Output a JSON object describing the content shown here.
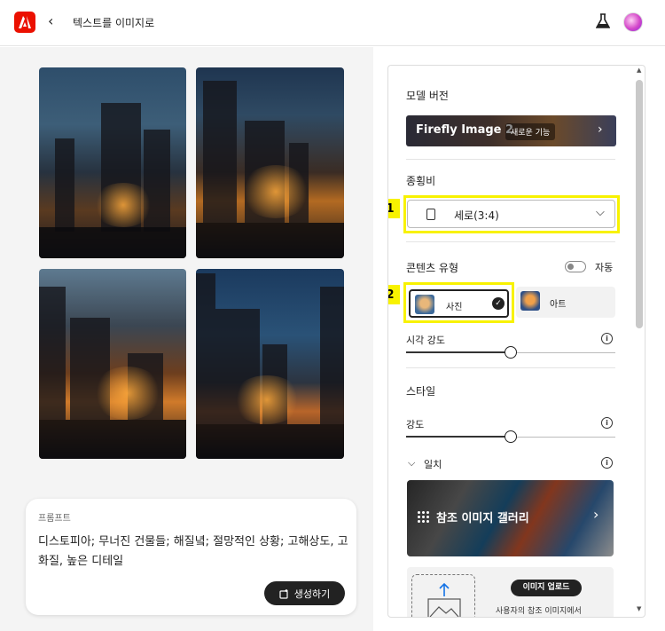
{
  "header": {
    "back_icon": "chevron-left-icon",
    "title": "텍스트를 이미지로",
    "lab_icon": "flask-icon",
    "avatar_icon": "user-avatar"
  },
  "images": [
    {
      "alt": "dystopian ruined buildings 1"
    },
    {
      "alt": "dystopian ruined buildings 2"
    },
    {
      "alt": "dystopian ruined buildings 3"
    },
    {
      "alt": "dystopian ruined buildings 4"
    }
  ],
  "prompt": {
    "label": "프롬프트",
    "text": "디스토피아; 무너진 건물들; 해질녘; 절망적인 상황; 고해상도, 고화질, 높은 디테일",
    "generate_label": "생성하기"
  },
  "panel": {
    "model": {
      "title": "모델 버전",
      "name": "Firefly Image 2",
      "badge": "새로운 기능"
    },
    "aspect": {
      "title": "종횡비",
      "value": "세로(3:4)"
    },
    "content_type": {
      "title": "콘텐츠 유형",
      "auto_label": "자동",
      "auto_on": false,
      "photo_label": "사진",
      "art_label": "아트",
      "selected": "사진"
    },
    "visual_intensity": {
      "label": "시각 강도",
      "value": 0.5
    },
    "style": {
      "title": "스타일",
      "strength_label": "강도",
      "strength_value": 0.5,
      "match_label": "일치"
    },
    "gallery": {
      "label": "참조 이미지 갤러리"
    },
    "upload": {
      "button_label": "이미지 업로드",
      "desc": "사용자의 참조 이미지에서"
    }
  },
  "annotations": {
    "one": "1",
    "two": "2",
    "color": "#f8f200"
  }
}
